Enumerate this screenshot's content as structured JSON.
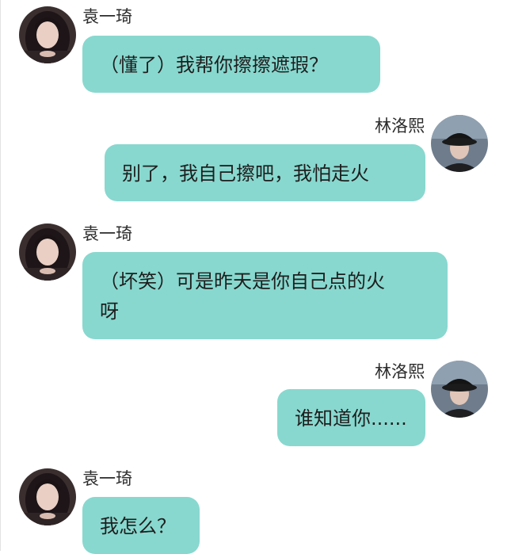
{
  "contacts": {
    "left_name": "袁一琦",
    "right_name": "林洛熙",
    "left_avatar_icon": "female-portrait-avatar-icon",
    "right_avatar_icon": "bucket-hat-portrait-avatar-icon"
  },
  "colors": {
    "bubble": "#88d8cf",
    "background": "#ffffff",
    "text": "#1e1e1e"
  },
  "messages": [
    {
      "sender": "袁一琦",
      "side": "left",
      "text": "（懂了）我帮你擦擦遮瑕？"
    },
    {
      "sender": "林洛熙",
      "side": "right",
      "text": "别了，我自己擦吧，我怕走火"
    },
    {
      "sender": "袁一琦",
      "side": "left",
      "line1": "（坏笑）可是昨天是你自己点的火",
      "line2": "呀"
    },
    {
      "sender": "林洛熙",
      "side": "right",
      "text": "谁知道你......"
    },
    {
      "sender": "袁一琦",
      "side": "left",
      "text": "我怎么？"
    }
  ]
}
